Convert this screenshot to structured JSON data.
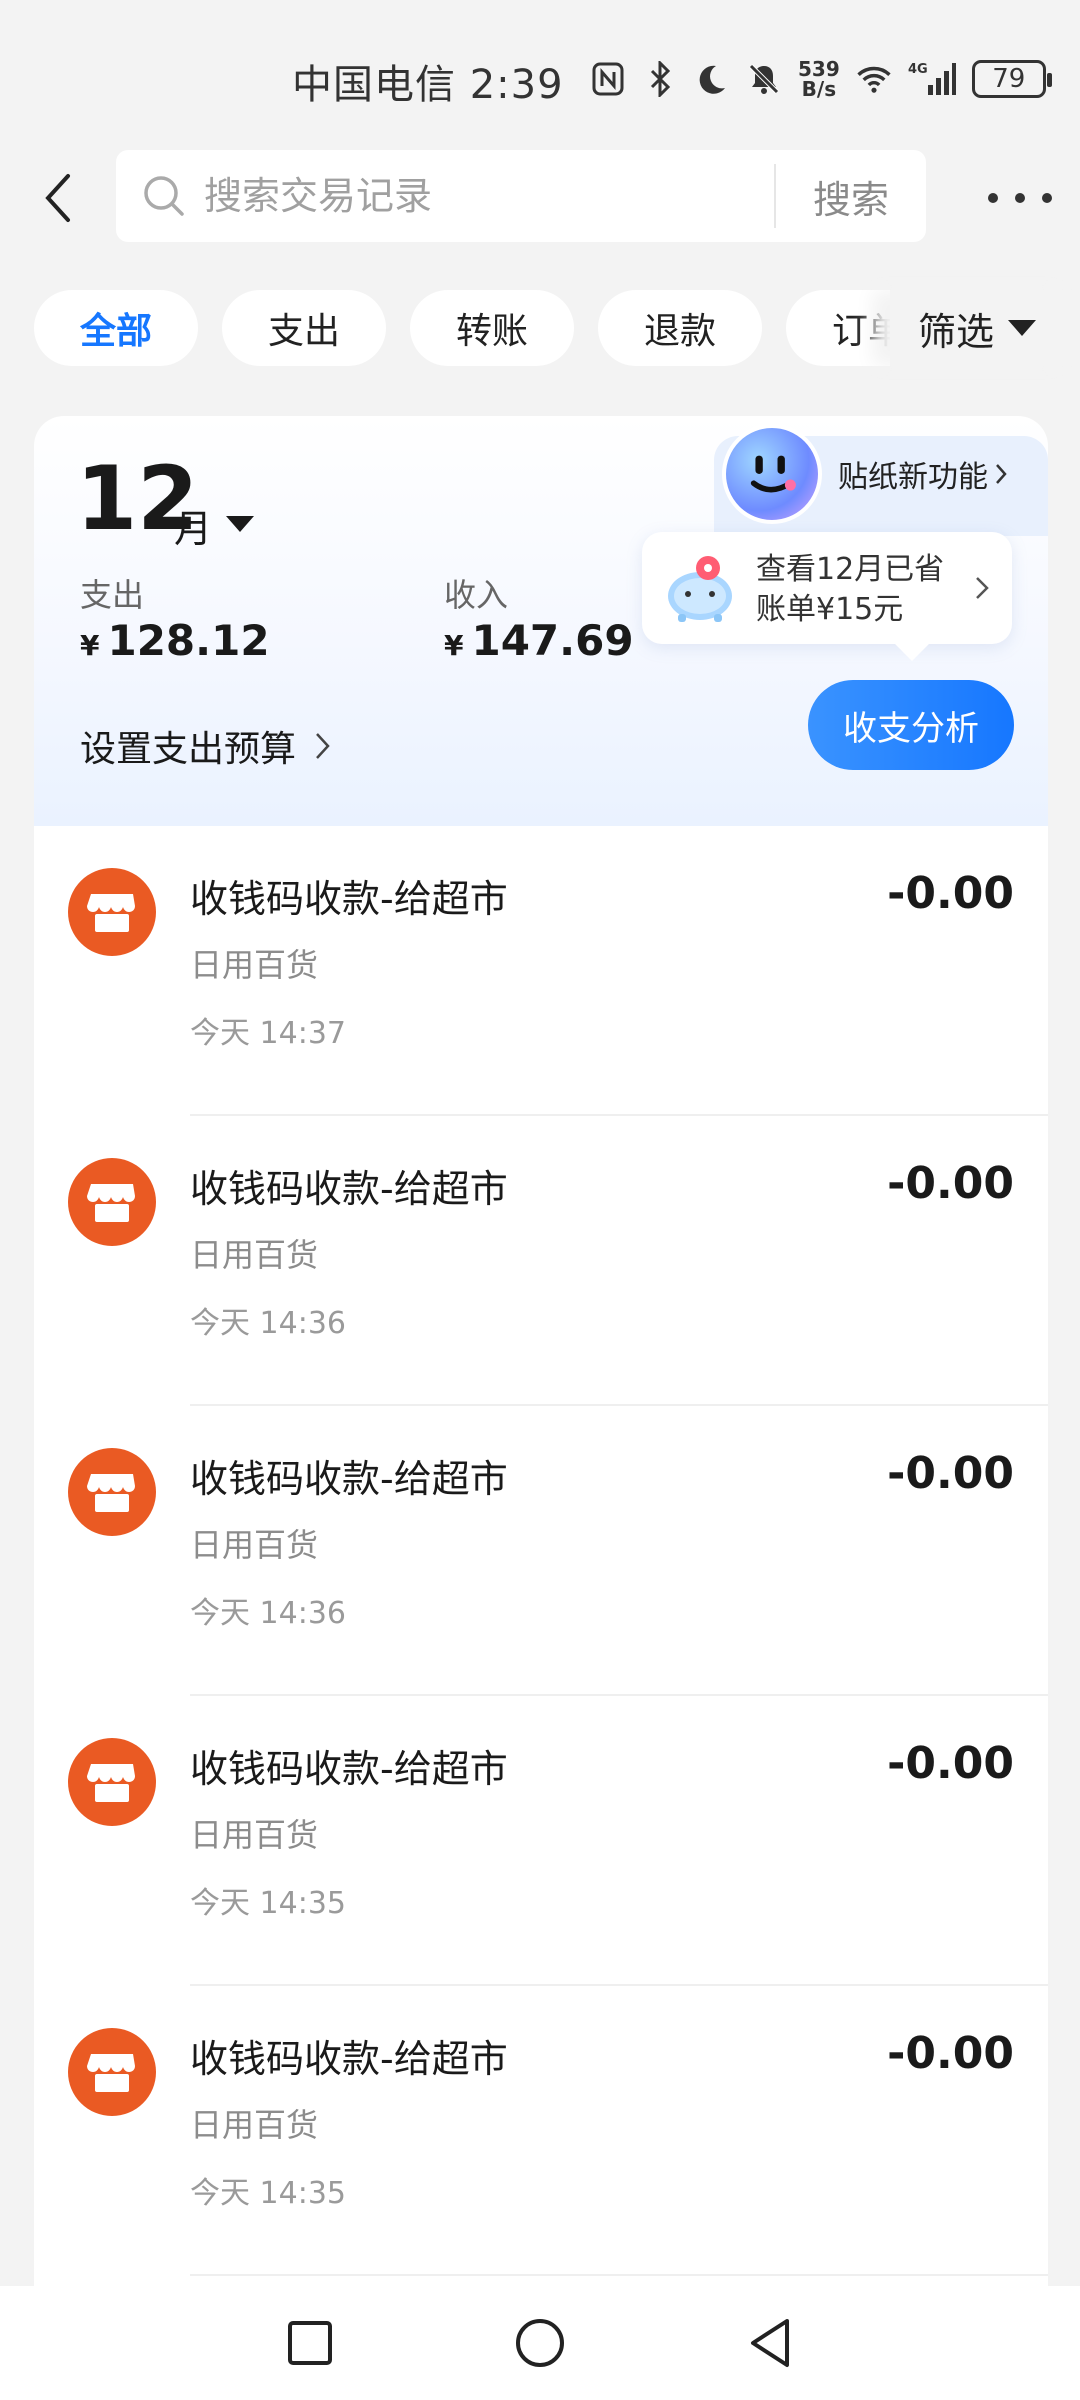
{
  "status_bar": {
    "carrier_time": "中国电信 2:39",
    "net_speed_value": "539",
    "net_speed_unit": "B/s",
    "network": "4G",
    "battery": "79"
  },
  "header": {
    "search_placeholder": "搜索交易记录",
    "search_button": "搜索"
  },
  "filters": {
    "tabs": [
      {
        "label": "全部",
        "active": true
      },
      {
        "label": "支出",
        "active": false
      },
      {
        "label": "转账",
        "active": false
      },
      {
        "label": "退款",
        "active": false
      },
      {
        "label": "订单",
        "active": false
      }
    ],
    "filter_label": "筛选"
  },
  "summary": {
    "month": "12",
    "month_unit": "月",
    "expense_label": "支出",
    "expense_currency": "¥",
    "expense_value": "128.12",
    "income_label": "收入",
    "income_currency": "¥",
    "income_value": "147.69",
    "sticker_label": "贴纸新功能",
    "save_line1": "查看12月已省",
    "save_line2": "账单¥15元",
    "analysis_button": "收支分析",
    "budget_label": "设置支出预算"
  },
  "transactions": [
    {
      "title": "收钱码收款-给超市",
      "category": "日用百货",
      "time": "今天 14:37",
      "amount": "-0.00"
    },
    {
      "title": "收钱码收款-给超市",
      "category": "日用百货",
      "time": "今天 14:36",
      "amount": "-0.00"
    },
    {
      "title": "收钱码收款-给超市",
      "category": "日用百货",
      "time": "今天 14:36",
      "amount": "-0.00"
    },
    {
      "title": "收钱码收款-给超市",
      "category": "日用百货",
      "time": "今天 14:35",
      "amount": "-0.00"
    },
    {
      "title": "收钱码收款-给超市",
      "category": "日用百货",
      "time": "今天 14:35",
      "amount": "-0.00"
    }
  ],
  "colors": {
    "accent": "#1677ff",
    "merchant_icon": "#ea5a23",
    "background": "#f3f3f3"
  }
}
